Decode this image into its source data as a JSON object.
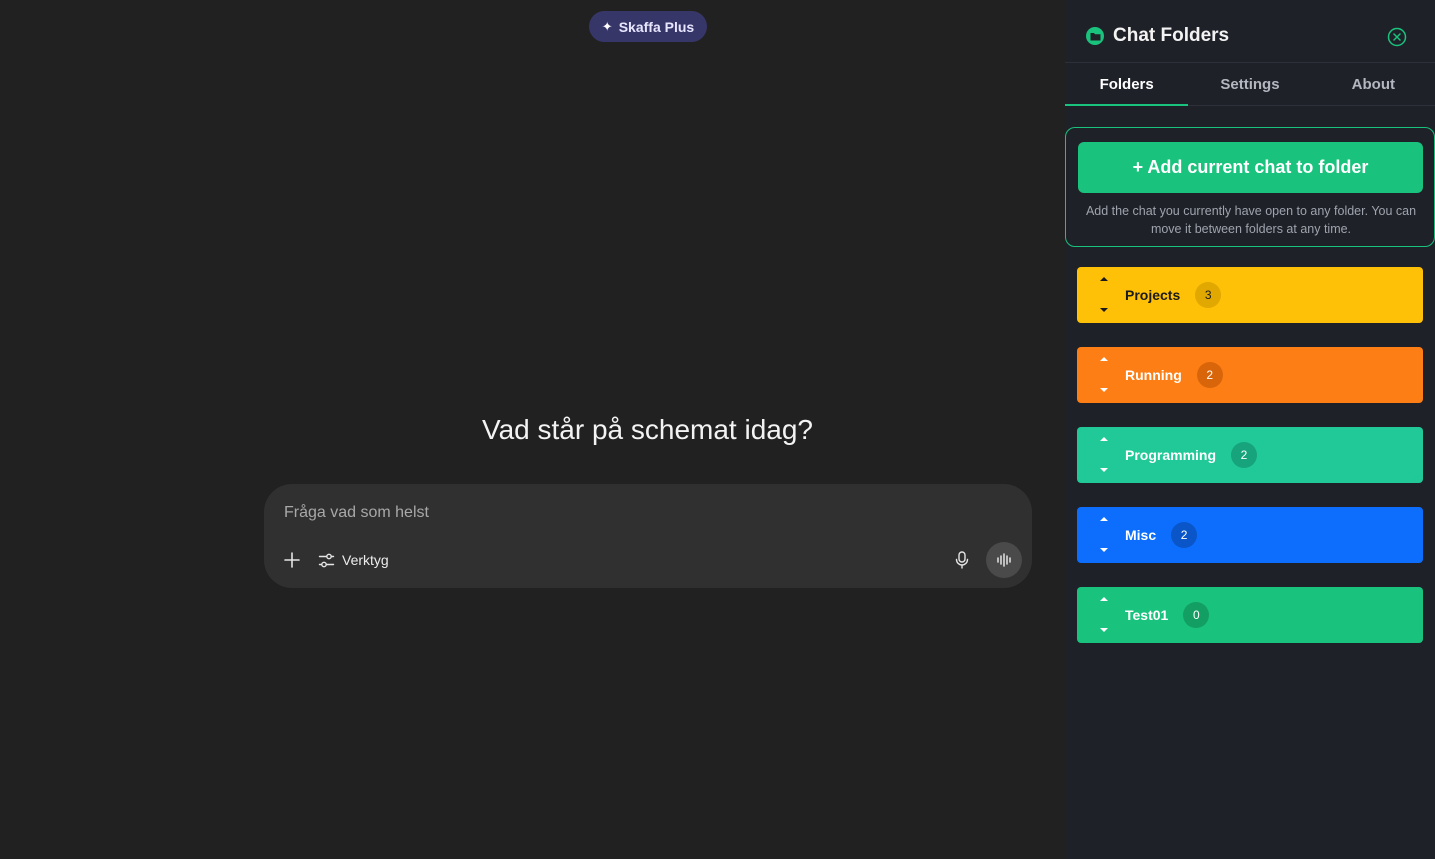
{
  "main": {
    "upgrade_label": "Skaffa Plus",
    "headline": "Vad står på schemat idag?",
    "composer": {
      "placeholder": "Fråga vad som helst",
      "tools_label": "Verktyg"
    }
  },
  "panel": {
    "title": "Chat Folders",
    "tabs": [
      {
        "label": "Folders",
        "active": true
      },
      {
        "label": "Settings",
        "active": false
      },
      {
        "label": "About",
        "active": false
      }
    ],
    "add_button_label": "+ Add current chat to folder",
    "add_description": "Add the chat you currently have open to any folder. You can move it between folders at any time.",
    "folders": [
      {
        "name": "Projects",
        "count": "3",
        "color": "#ffc107",
        "text_color": "#1a1a1a",
        "badge_bg": "#e0a800",
        "badge_text": "#1a1a1a"
      },
      {
        "name": "Running",
        "count": "2",
        "color": "#fd7e14",
        "text_color": "#ffffff",
        "badge_bg": "#d9650a",
        "badge_text": "#ffffff"
      },
      {
        "name": "Programming",
        "count": "2",
        "color": "#20c997",
        "text_color": "#ffffff",
        "badge_bg": "#17a37b",
        "badge_text": "#ffffff"
      },
      {
        "name": "Misc",
        "count": "2",
        "color": "#0d6efd",
        "text_color": "#ffffff",
        "badge_bg": "#0a56c8",
        "badge_text": "#ffffff"
      },
      {
        "name": "Test01",
        "count": "0",
        "color": "#19c37d",
        "text_color": "#ffffff",
        "badge_bg": "#139e64",
        "badge_text": "#ffffff"
      }
    ]
  },
  "colors": {
    "accent": "#19c37d",
    "background": "#212121",
    "panel_background": "#1f2128"
  }
}
